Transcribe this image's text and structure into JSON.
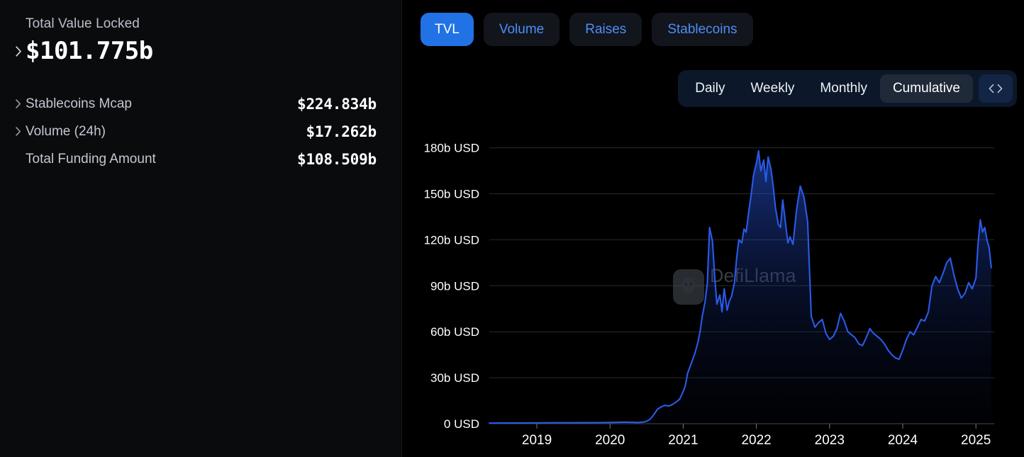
{
  "sidebar": {
    "tvl": {
      "label": "Total Value Locked",
      "value": "$101.775b",
      "expand_icon": "chevron-right-icon"
    },
    "stats": [
      {
        "label": "Stablecoins Mcap",
        "value": "$224.834b",
        "expandable": true
      },
      {
        "label": "Volume (24h)",
        "value": "$17.262b",
        "expandable": true
      },
      {
        "label": "Total Funding Amount",
        "value": "$108.509b",
        "expandable": false
      }
    ]
  },
  "panel": {
    "tabs": [
      {
        "label": "TVL",
        "active": true
      },
      {
        "label": "Volume",
        "active": false
      },
      {
        "label": "Raises",
        "active": false
      },
      {
        "label": "Stablecoins",
        "active": false
      }
    ],
    "frequency": {
      "options": [
        {
          "label": "Daily",
          "selected": false
        },
        {
          "label": "Weekly",
          "selected": false
        },
        {
          "label": "Monthly",
          "selected": false
        },
        {
          "label": "Cumulative",
          "selected": true
        }
      ],
      "embed_icon": "code-brackets-icon"
    }
  },
  "watermark": {
    "text": "DefiLlama",
    "icon": "llama-logo-icon"
  },
  "colors": {
    "accent": "#2172e5",
    "tab_text": "#4b8ef7",
    "line": "#2a5ae8",
    "panel_bg": "#000000",
    "sidebar_bg": "#0a0b0d",
    "freqbar_bg": "#0c1729",
    "selected_freq_bg": "#1f2937"
  },
  "chart_data": {
    "type": "area",
    "title": "",
    "xlabel": "",
    "ylabel": "USD",
    "ylim": [
      0,
      195
    ],
    "xlim": [
      2018.35,
      2025.25
    ],
    "grid": true,
    "legend": null,
    "y_ticks": [
      0,
      30,
      60,
      90,
      120,
      150,
      180
    ],
    "y_tick_labels": [
      "0 USD",
      "30b USD",
      "60b USD",
      "90b USD",
      "120b USD",
      "150b USD",
      "180b USD"
    ],
    "x_ticks": [
      2019,
      2020,
      2021,
      2022,
      2023,
      2024,
      2025
    ],
    "x_tick_labels": [
      "2019",
      "2020",
      "2021",
      "2022",
      "2023",
      "2024",
      "2025"
    ],
    "series": [
      {
        "name": "Total Value Locked",
        "unit": "b USD",
        "color": "#2a5ae8",
        "x": [
          2018.35,
          2018.5,
          2018.7,
          2018.9,
          2019.0,
          2019.2,
          2019.4,
          2019.6,
          2019.8,
          2020.0,
          2020.1,
          2020.2,
          2020.3,
          2020.38,
          2020.45,
          2020.5,
          2020.55,
          2020.6,
          2020.65,
          2020.7,
          2020.75,
          2020.8,
          2020.85,
          2020.9,
          2020.95,
          2021.0,
          2021.03,
          2021.06,
          2021.1,
          2021.13,
          2021.16,
          2021.2,
          2021.23,
          2021.26,
          2021.3,
          2021.33,
          2021.36,
          2021.4,
          2021.43,
          2021.46,
          2021.5,
          2021.53,
          2021.56,
          2021.6,
          2021.63,
          2021.66,
          2021.7,
          2021.73,
          2021.76,
          2021.8,
          2021.83,
          2021.86,
          2021.9,
          2021.93,
          2021.96,
          2022.0,
          2022.03,
          2022.06,
          2022.1,
          2022.13,
          2022.16,
          2022.2,
          2022.23,
          2022.26,
          2022.3,
          2022.33,
          2022.36,
          2022.4,
          2022.43,
          2022.46,
          2022.5,
          2022.55,
          2022.6,
          2022.65,
          2022.7,
          2022.75,
          2022.8,
          2022.85,
          2022.9,
          2022.95,
          2023.0,
          2023.05,
          2023.1,
          2023.15,
          2023.2,
          2023.25,
          2023.3,
          2023.35,
          2023.4,
          2023.45,
          2023.5,
          2023.55,
          2023.6,
          2023.65,
          2023.7,
          2023.75,
          2023.8,
          2023.85,
          2023.9,
          2023.95,
          2024.0,
          2024.05,
          2024.1,
          2024.15,
          2024.2,
          2024.25,
          2024.3,
          2024.35,
          2024.4,
          2024.45,
          2024.5,
          2024.55,
          2024.6,
          2024.65,
          2024.7,
          2024.75,
          2024.8,
          2024.85,
          2024.9,
          2024.95,
          2025.0,
          2025.03,
          2025.06,
          2025.09,
          2025.12,
          2025.15,
          2025.18,
          2025.21
        ],
        "values": [
          0.4,
          0.45,
          0.5,
          0.5,
          0.55,
          0.6,
          0.6,
          0.65,
          0.7,
          0.8,
          0.9,
          1.0,
          0.9,
          0.8,
          1.0,
          1.6,
          3.0,
          6.0,
          9.5,
          11.0,
          12.0,
          11.5,
          12.5,
          14.0,
          16.0,
          21.0,
          25.0,
          33.0,
          38.0,
          42.0,
          46.0,
          53.0,
          60.0,
          70.0,
          80.0,
          92.0,
          128.0,
          119.0,
          96.0,
          78.0,
          84.0,
          73.0,
          88.0,
          74.0,
          80.0,
          83.0,
          92.0,
          108.0,
          120.0,
          118.0,
          127.0,
          125.0,
          140.0,
          150.0,
          162.0,
          170.0,
          178.0,
          165.0,
          172.0,
          158.0,
          174.0,
          166.0,
          155.0,
          141.0,
          130.0,
          128.0,
          146.0,
          130.0,
          118.0,
          122.0,
          117.0,
          140.0,
          155.0,
          148.0,
          132.0,
          70.0,
          63.0,
          66.0,
          68.0,
          59.0,
          55.0,
          57.0,
          62.0,
          72.0,
          67.0,
          60.0,
          58.0,
          56.0,
          52.0,
          51.0,
          56.0,
          62.0,
          59.0,
          57.0,
          55.0,
          52.0,
          48.0,
          45.0,
          43.0,
          42.0,
          48.0,
          55.0,
          60.0,
          58.0,
          63.0,
          68.0,
          67.0,
          73.0,
          90.0,
          96.0,
          92.0,
          98.0,
          105.0,
          108.0,
          97.0,
          88.0,
          82.0,
          85.0,
          92.0,
          88.0,
          95.0,
          118.0,
          133.0,
          125.0,
          128.0,
          120.0,
          115.0,
          101.775
        ]
      }
    ]
  }
}
